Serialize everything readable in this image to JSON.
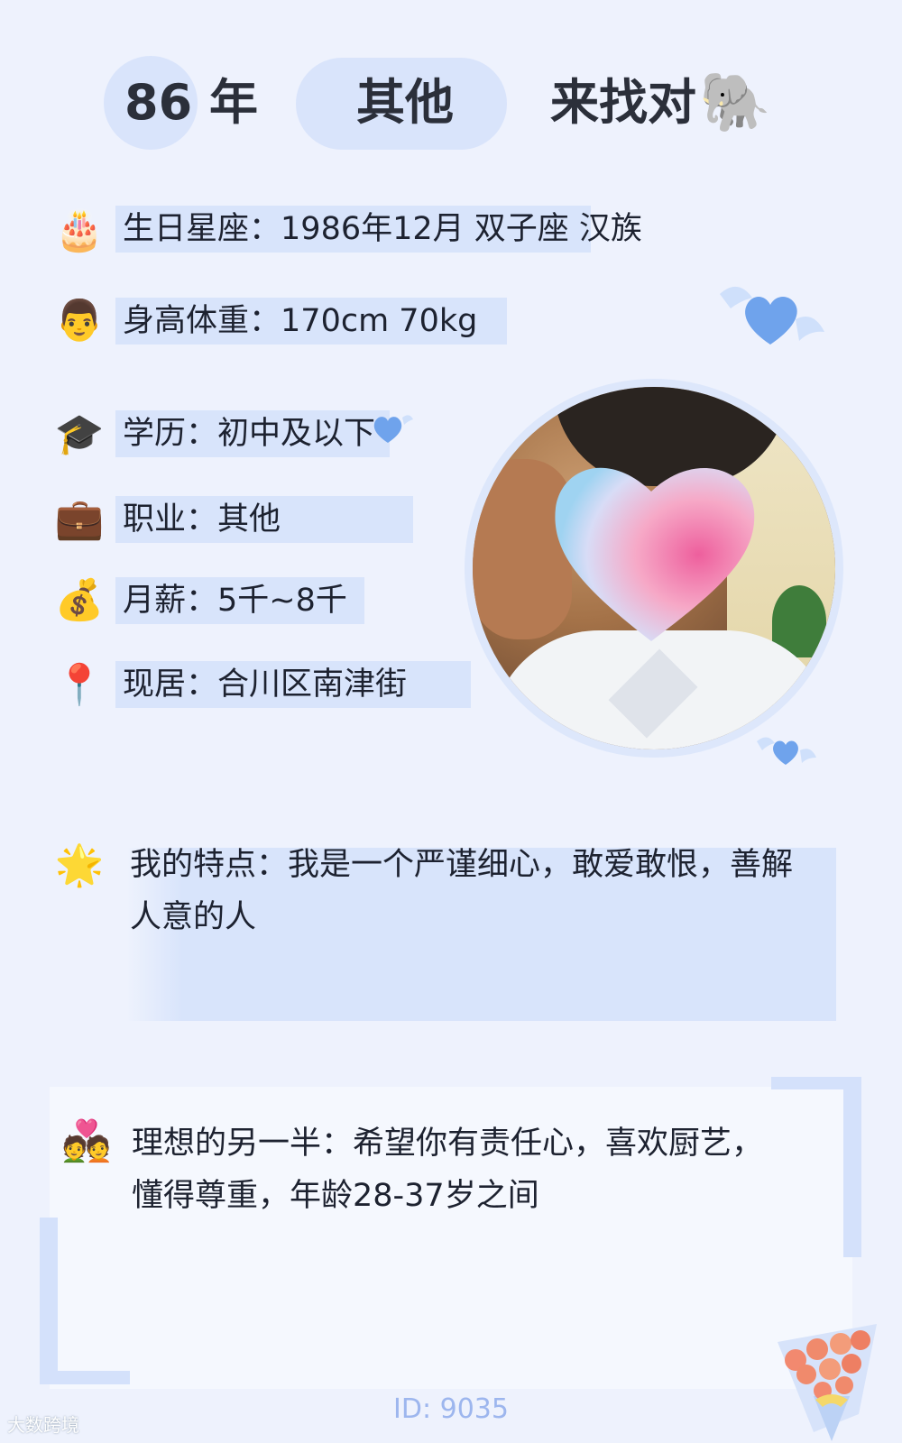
{
  "header": {
    "age_number": "86",
    "age_unit": "年",
    "occupation_tag": "其他",
    "slogan": "来找对",
    "slogan_emoji": "🐘"
  },
  "profile": {
    "birthday": {
      "icon": "🎂",
      "label": "生日星座",
      "value": "1986年12月 双子座 汉族"
    },
    "height_weight": {
      "icon": "👨",
      "label": "身高体重",
      "value": "170cm 70kg"
    },
    "education": {
      "icon": "🎓",
      "label": "学历",
      "value": "初中及以下"
    },
    "job": {
      "icon": "💼",
      "label": "职业",
      "value": "其他"
    },
    "salary": {
      "icon": "💰",
      "label": "月薪",
      "value": "5千~8千"
    },
    "residence": {
      "icon": "📍",
      "label": "现居",
      "value": "合川区南津街"
    }
  },
  "features": {
    "icon": "🌟",
    "label": "我的特点",
    "text": "我是一个严谨细心，敢爱敢恨，善解人意的人"
  },
  "ideal_partner": {
    "icon": "💑",
    "label": "理想的另一半",
    "text": "希望你有责任心，喜欢厨艺，懂得尊重，年龄28-37岁之间"
  },
  "footer": {
    "id_text": "ID: 9035",
    "watermark": "大数跨境"
  },
  "colors": {
    "background": "#eef2fd",
    "highlight": "#d8e4fb",
    "accent_blue": "#6fa3ec",
    "id_text": "#9db6ee"
  }
}
